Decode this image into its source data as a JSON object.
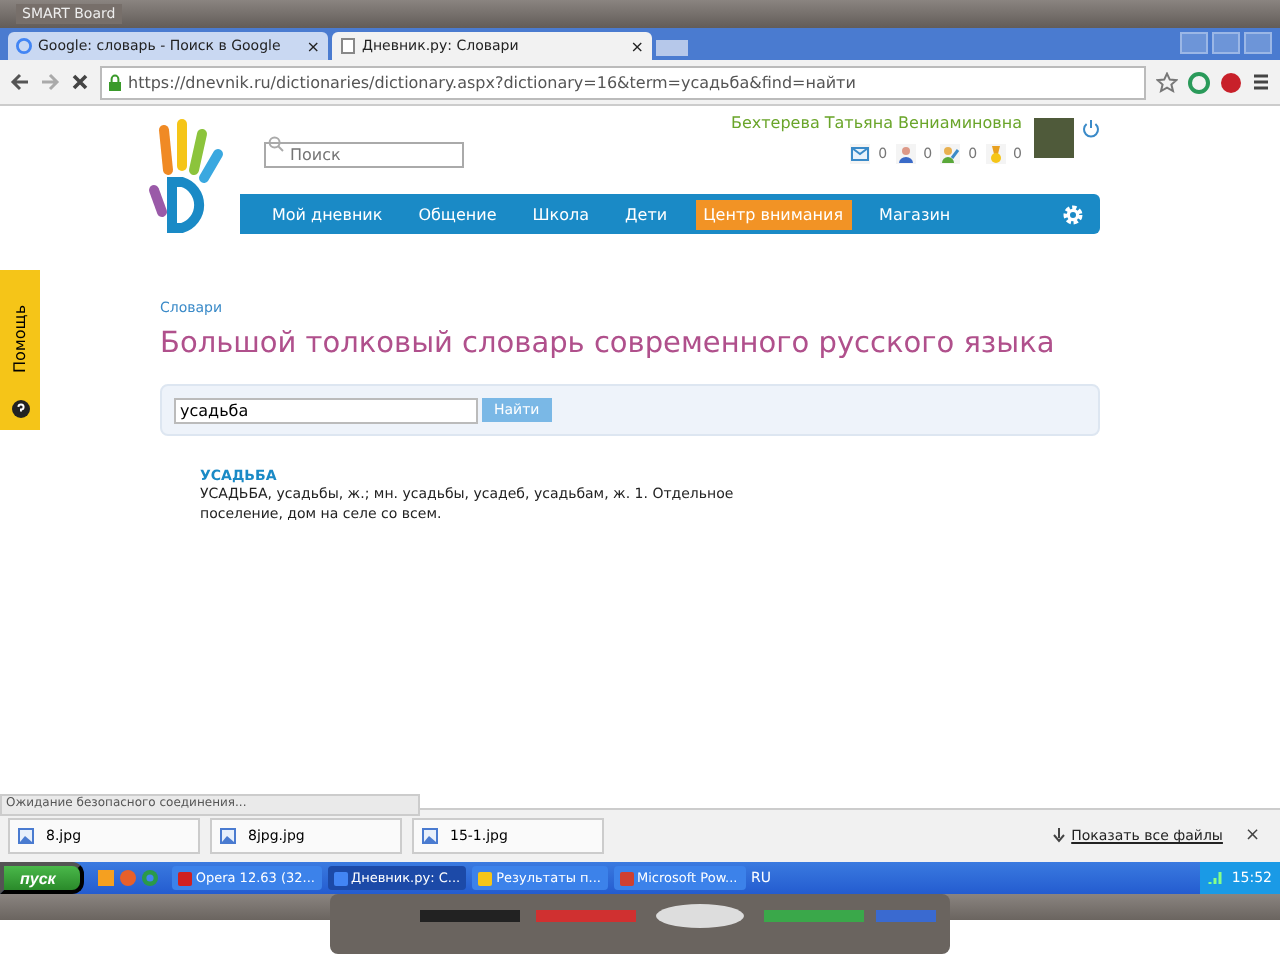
{
  "smart_bar": {
    "title": "SMART Board"
  },
  "browser": {
    "tabs": [
      {
        "title": "Google: словарь - Поиск в Google",
        "selected": false,
        "close": "×"
      },
      {
        "title": "Дневник.ру: Словари",
        "selected": true,
        "close": "×"
      }
    ],
    "address": "https://dnevnik.ru/dictionaries/dictionary.aspx?dictionary=16&term=усадьба&find=найти"
  },
  "site": {
    "search": {
      "placeholder": "Поиск"
    },
    "user": {
      "name": "Бехтерева Татьяна Вениаминовна"
    },
    "counters": [
      {
        "kind": "mail",
        "count": "0"
      },
      {
        "kind": "person",
        "count": "0"
      },
      {
        "kind": "pencil",
        "count": "0"
      },
      {
        "kind": "medal",
        "count": "0"
      }
    ],
    "nav": [
      {
        "label": "Мой дневник",
        "selected": false
      },
      {
        "label": "Общение",
        "selected": false
      },
      {
        "label": "Школа",
        "selected": false
      },
      {
        "label": "Дети",
        "selected": false
      },
      {
        "label": "Центр внимания",
        "selected": true
      },
      {
        "label": "Магазин",
        "selected": false
      }
    ],
    "help": "Помощь",
    "breadcrumb": "Словари",
    "title": "Большой толковый словарь современного русского языка",
    "query": {
      "value": "усадьба",
      "button": "Найти"
    },
    "result": {
      "term": "УСАДЬБА",
      "definition": "УСАДЬБА, усадьбы, ж.; мн. усадьбы, усадеб, усадьбам, ж. 1. Отдельное поселение, дом на селе со всем."
    }
  },
  "status": "Ожидание безопасного соединения...",
  "downloads": {
    "files": [
      "8.jpg",
      "8jpg.jpg",
      "15-1.jpg"
    ],
    "show_all": "Показать все файлы",
    "close": "×"
  },
  "taskbar": {
    "start": "пуск",
    "tasks": [
      {
        "label": "Opera 12.63 (32...",
        "selected": false
      },
      {
        "label": "Дневник.ру: С...",
        "selected": true
      },
      {
        "label": "Результаты п...",
        "selected": false
      },
      {
        "label": "Microsoft Pow...",
        "selected": false
      }
    ],
    "language": "RU",
    "clock": "15:52"
  }
}
